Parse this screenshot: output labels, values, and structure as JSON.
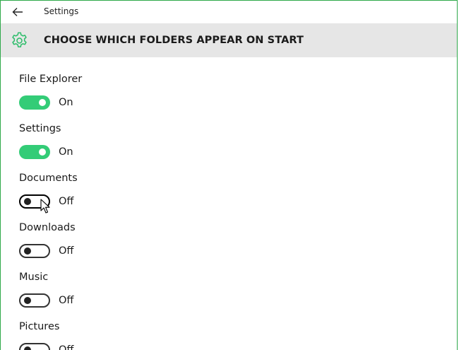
{
  "window": {
    "title": "Settings",
    "accent_color": "#33cc77",
    "frame_color": "#2fa94a"
  },
  "titlebar": {
    "back_icon": "back-arrow-icon"
  },
  "header": {
    "icon": "gear-icon",
    "title": "CHOOSE WHICH FOLDERS APPEAR ON START"
  },
  "settings": [
    {
      "label": "File Explorer",
      "state": "On",
      "enabled": true
    },
    {
      "label": "Settings",
      "state": "On",
      "enabled": true
    },
    {
      "label": "Documents",
      "state": "Off",
      "enabled": false
    },
    {
      "label": "Downloads",
      "state": "Off",
      "enabled": false
    },
    {
      "label": "Music",
      "state": "Off",
      "enabled": false
    },
    {
      "label": "Pictures",
      "state": "Off",
      "enabled": false
    }
  ]
}
